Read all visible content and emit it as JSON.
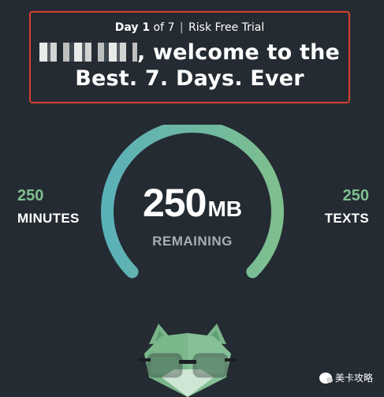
{
  "banner": {
    "day_label": "Day 1",
    "of_label": " of 7",
    "separator": "|",
    "trial_label": "Risk Free Trial",
    "welcome_line1": ", welcome to the",
    "welcome_line2": "Best. 7. Days. Ever",
    "border_color": "#d8412f"
  },
  "gauge": {
    "value": "250",
    "unit": "MB",
    "caption": "REMAINING",
    "fraction_remaining": 1.0,
    "color_start": "#7fbf8e",
    "color_end": "#5bb1b8"
  },
  "minutes": {
    "count": "250",
    "label": "MINUTES"
  },
  "texts": {
    "count": "250",
    "label": "TEXTS"
  },
  "mascot": {
    "icon": "fox-glasses-icon"
  },
  "watermark": {
    "text": "美卡攻略",
    "icon": "wechat-icon"
  }
}
